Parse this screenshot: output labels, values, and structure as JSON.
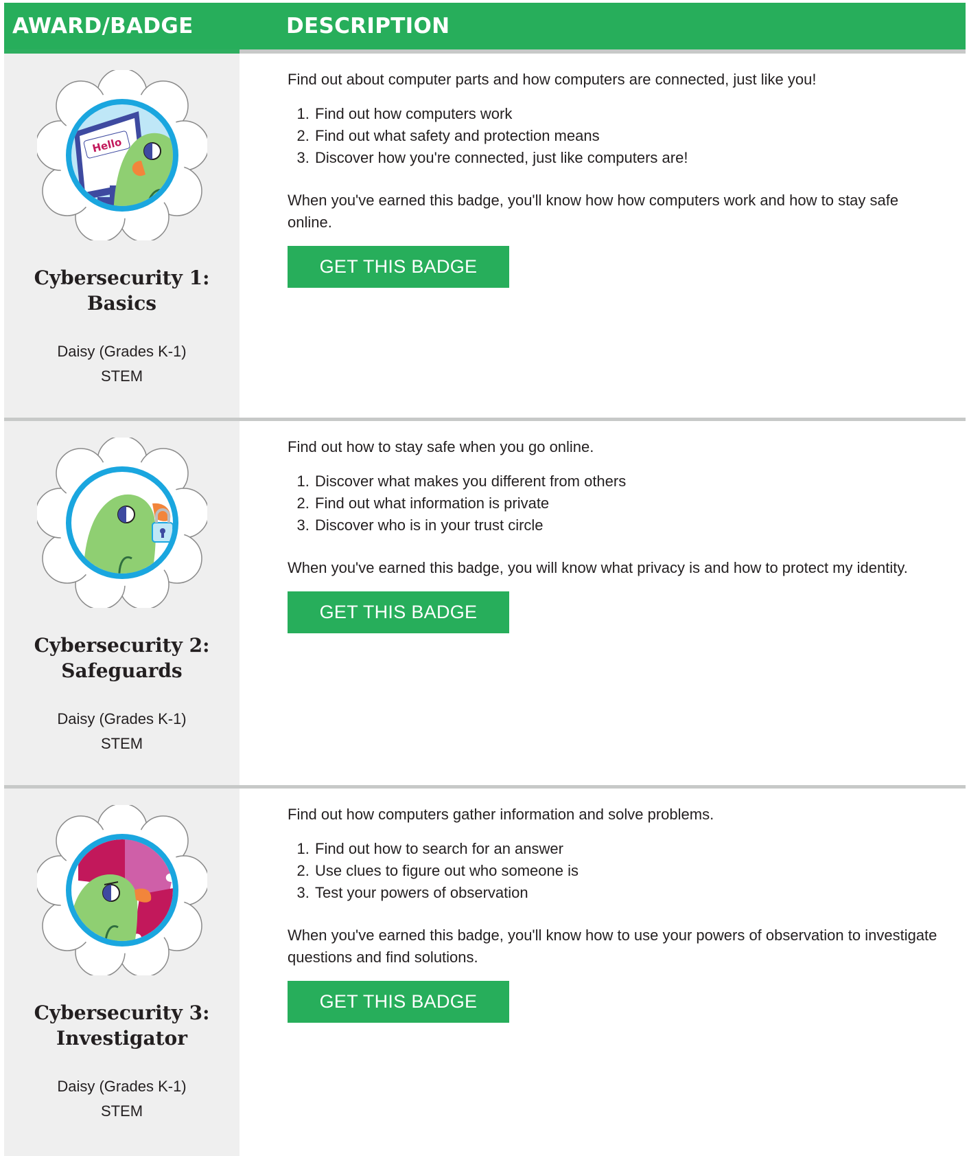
{
  "header": {
    "col_award": "AWARD/BADGE",
    "col_description": "DESCRIPTION"
  },
  "colors": {
    "brand_green": "#27ae5b",
    "divider_gray": "#c7c9c8",
    "left_panel_bg": "#efefef",
    "badge_ring_blue": "#1aa6df"
  },
  "badges": [
    {
      "icon": "parrot-computer-hello-icon",
      "title_line1": "Cybersecurity 1:",
      "title_line2": "Basics",
      "level": "Daisy (Grades K-1)",
      "category": "STEM",
      "intro": "Find out about computer parts and how computers are connected, just like you!",
      "steps": [
        "Find out how computers work",
        "Find out what safety and protection means",
        "Discover how you're connected, just like computers are!"
      ],
      "outcome": "When you've earned this badge, you'll know how how computers work and how to stay safe online.",
      "button_label": "GET THIS BADGE",
      "hello_text": "Hello"
    },
    {
      "icon": "parrot-padlock-icon",
      "title_line1": "Cybersecurity 2:",
      "title_line2": "Safeguards",
      "level": "Daisy (Grades K-1)",
      "category": "STEM",
      "intro": "Find out how to stay safe when you go online.",
      "steps": [
        "Discover what makes you different from others",
        "Find out what information is private",
        "Discover who is in your trust circle"
      ],
      "outcome": "When you've earned this badge, you will know what privacy is and how to protect my identity.",
      "button_label": "GET THIS BADGE"
    },
    {
      "icon": "parrot-puzzle-icon",
      "title_line1": "Cybersecurity 3:",
      "title_line2": "Investigator",
      "level": "Daisy (Grades K-1)",
      "category": "STEM",
      "intro": "Find out how computers gather information and solve problems.",
      "steps": [
        "Find out how to search for an answer",
        "Use clues to figure out who someone is",
        "Test your powers of observation"
      ],
      "outcome": "When you've earned this badge, you'll know how to use your powers of observation to investigate questions and find solutions.",
      "button_label": "GET THIS BADGE"
    }
  ]
}
